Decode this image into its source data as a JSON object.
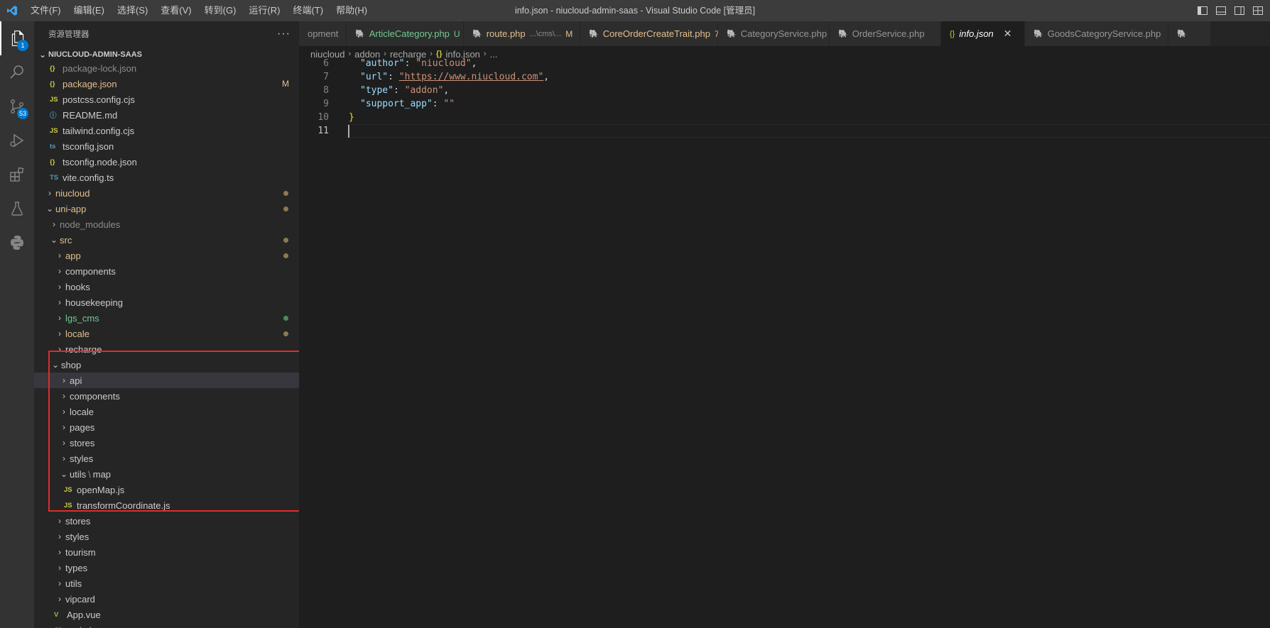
{
  "titlebar": {
    "menu": [
      "文件(F)",
      "编辑(E)",
      "选择(S)",
      "查看(V)",
      "转到(G)",
      "运行(R)",
      "终端(T)",
      "帮助(H)"
    ],
    "window_title": "info.json - niucloud-admin-saas - Visual Studio Code [管理员]"
  },
  "activitybar": {
    "explorer_badge": "1",
    "scm_badge": "53"
  },
  "sidebar": {
    "header": "资源管理器",
    "more": "···",
    "section_title": "NIUCLOUD-ADMIN-SAAS",
    "tree": [
      {
        "label": "package-lock.json",
        "icon": "{}",
        "chev": "",
        "cls": "dim"
      },
      {
        "label": "package.json",
        "icon": "{}",
        "chev": "",
        "cls": "git-mod",
        "mark": "M"
      },
      {
        "label": "postcss.config.cjs",
        "icon": "JS",
        "chev": "",
        "cls": ""
      },
      {
        "label": "README.md",
        "icon": "ⓘ",
        "chev": "",
        "cls": ""
      },
      {
        "label": "tailwind.config.cjs",
        "icon": "JS",
        "chev": "",
        "cls": ""
      },
      {
        "label": "tsconfig.json",
        "icon": "ts",
        "chev": "",
        "cls": ""
      },
      {
        "label": "tsconfig.node.json",
        "icon": "{}",
        "chev": "",
        "cls": ""
      },
      {
        "label": "vite.config.ts",
        "icon": "TS",
        "chev": "",
        "cls": ""
      },
      {
        "label": "niucloud",
        "icon": "",
        "chev": "›",
        "cls": "git-mod",
        "dot": "mod"
      },
      {
        "label": "uni-app",
        "icon": "",
        "chev": "⌄",
        "cls": "git-mod",
        "dot": "mod"
      },
      {
        "label": "node_modules",
        "icon": "",
        "chev": "›",
        "cls": "dim"
      },
      {
        "label": "src",
        "icon": "",
        "chev": "⌄",
        "cls": "git-mod",
        "dot": "mod"
      },
      {
        "label": "app",
        "icon": "",
        "chev": "›",
        "cls": "git-mod",
        "dot": "mod"
      },
      {
        "label": "components",
        "icon": "",
        "chev": "›",
        "cls": ""
      },
      {
        "label": "hooks",
        "icon": "",
        "chev": "›",
        "cls": ""
      },
      {
        "label": "housekeeping",
        "icon": "",
        "chev": "›",
        "cls": ""
      },
      {
        "label": "lgs_cms",
        "icon": "",
        "chev": "›",
        "cls": "git-new",
        "dot": "new"
      },
      {
        "label": "locale",
        "icon": "",
        "chev": "›",
        "cls": "git-mod",
        "dot": "mod"
      },
      {
        "label": "recharge",
        "icon": "",
        "chev": "›",
        "cls": ""
      },
      {
        "label": "shop",
        "icon": "",
        "chev": "⌄",
        "cls": ""
      },
      {
        "label": "api",
        "icon": "",
        "chev": "›",
        "cls": "",
        "selected": true
      },
      {
        "label": "components",
        "icon": "",
        "chev": "›",
        "cls": ""
      },
      {
        "label": "locale",
        "icon": "",
        "chev": "›",
        "cls": ""
      },
      {
        "label": "pages",
        "icon": "",
        "chev": "›",
        "cls": ""
      },
      {
        "label": "stores",
        "icon": "",
        "chev": "›",
        "cls": ""
      },
      {
        "label": "styles",
        "icon": "",
        "chev": "›",
        "cls": ""
      },
      {
        "label": "utils",
        "label2": "map",
        "icon": "",
        "chev": "⌄",
        "cls": ""
      },
      {
        "label": "openMap.js",
        "icon": "JS",
        "chev": "",
        "cls": ""
      },
      {
        "label": "transformCoordinate.js",
        "icon": "JS",
        "chev": "",
        "cls": ""
      },
      {
        "label": "stores",
        "icon": "",
        "chev": "›",
        "cls": ""
      },
      {
        "label": "styles",
        "icon": "",
        "chev": "›",
        "cls": ""
      },
      {
        "label": "tourism",
        "icon": "",
        "chev": "›",
        "cls": ""
      },
      {
        "label": "types",
        "icon": "",
        "chev": "›",
        "cls": ""
      },
      {
        "label": "utils",
        "icon": "",
        "chev": "›",
        "cls": ""
      },
      {
        "label": "vipcard",
        "icon": "",
        "chev": "›",
        "cls": ""
      },
      {
        "label": "App.vue",
        "icon": "V",
        "chev": "",
        "cls": ""
      },
      {
        "label": "main.js",
        "icon": "JS",
        "chev": "",
        "cls": ""
      }
    ]
  },
  "tabs": [
    {
      "label": "opment",
      "icon": "",
      "cls": "",
      "mark": "",
      "path": ""
    },
    {
      "label": "ArticleCategory.php",
      "icon": "php",
      "cls": "new",
      "mark": "U",
      "path": ""
    },
    {
      "label": "route.php",
      "icon": "php",
      "cls": "mod",
      "mark": "M",
      "path": "...\\cms\\..."
    },
    {
      "label": "CoreOrderCreateTrait.php",
      "icon": "php",
      "cls": "mod",
      "mark": "7",
      "path": ""
    },
    {
      "label": "CategoryService.php",
      "icon": "php",
      "cls": "",
      "mark": "",
      "path": ""
    },
    {
      "label": "OrderService.php",
      "icon": "php",
      "cls": "",
      "mark": "",
      "path": ""
    },
    {
      "label": "info.json",
      "icon": "{}",
      "cls": "italic",
      "mark": "",
      "path": "",
      "active": true,
      "close": "✕"
    },
    {
      "label": "GoodsCategoryService.php",
      "icon": "php",
      "cls": "",
      "mark": "",
      "path": ""
    },
    {
      "label": "",
      "icon": "php",
      "cls": "",
      "mark": "",
      "path": ""
    }
  ],
  "breadcrumb": [
    "niucloud",
    "addon",
    "recharge",
    "info.json",
    "..."
  ],
  "breadcrumb_file_icon": "{}",
  "editor": {
    "lines": [
      {
        "n": "6",
        "key": "\"author\"",
        "val": "\"niucloud\"",
        "trail": ","
      },
      {
        "n": "7",
        "key": "\"url\"",
        "val": "\"https://www.niucloud.com\"",
        "trail": ",",
        "url": true
      },
      {
        "n": "8",
        "key": "\"type\"",
        "val": "\"addon\"",
        "trail": ","
      },
      {
        "n": "9",
        "key": "\"support_app\"",
        "val": "\"\"",
        "trail": ""
      },
      {
        "n": "10",
        "brace": "}"
      },
      {
        "n": "11",
        "current": true
      }
    ]
  },
  "colors": {
    "accent": "#007acc",
    "git_modified": "#e2c08d",
    "git_untracked": "#73c991",
    "highlight_box": "#e02b2b"
  }
}
